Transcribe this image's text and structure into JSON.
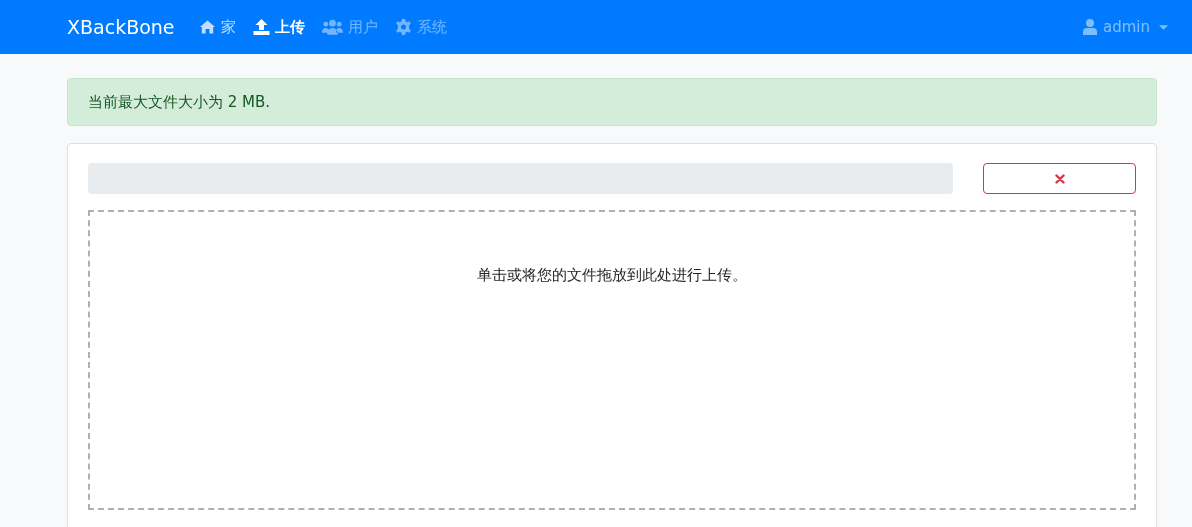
{
  "navbar": {
    "brand": "XBackBone",
    "items": [
      {
        "kind": "home",
        "label": "家",
        "selected": false,
        "disabled": false
      },
      {
        "kind": "upload",
        "label": "上传",
        "selected": true,
        "disabled": false
      },
      {
        "kind": "users",
        "label": "用户",
        "selected": false,
        "disabled": true
      },
      {
        "kind": "settings",
        "label": "系统",
        "selected": false,
        "disabled": true
      }
    ],
    "user": {
      "label": "admin"
    }
  },
  "alert": {
    "text": "当前最大文件大小为 2 MB."
  },
  "upload": {
    "progress": {
      "level": 0
    },
    "dropzone": {
      "text": "单击或将您的文件拖放到此处进行上传。"
    }
  }
}
